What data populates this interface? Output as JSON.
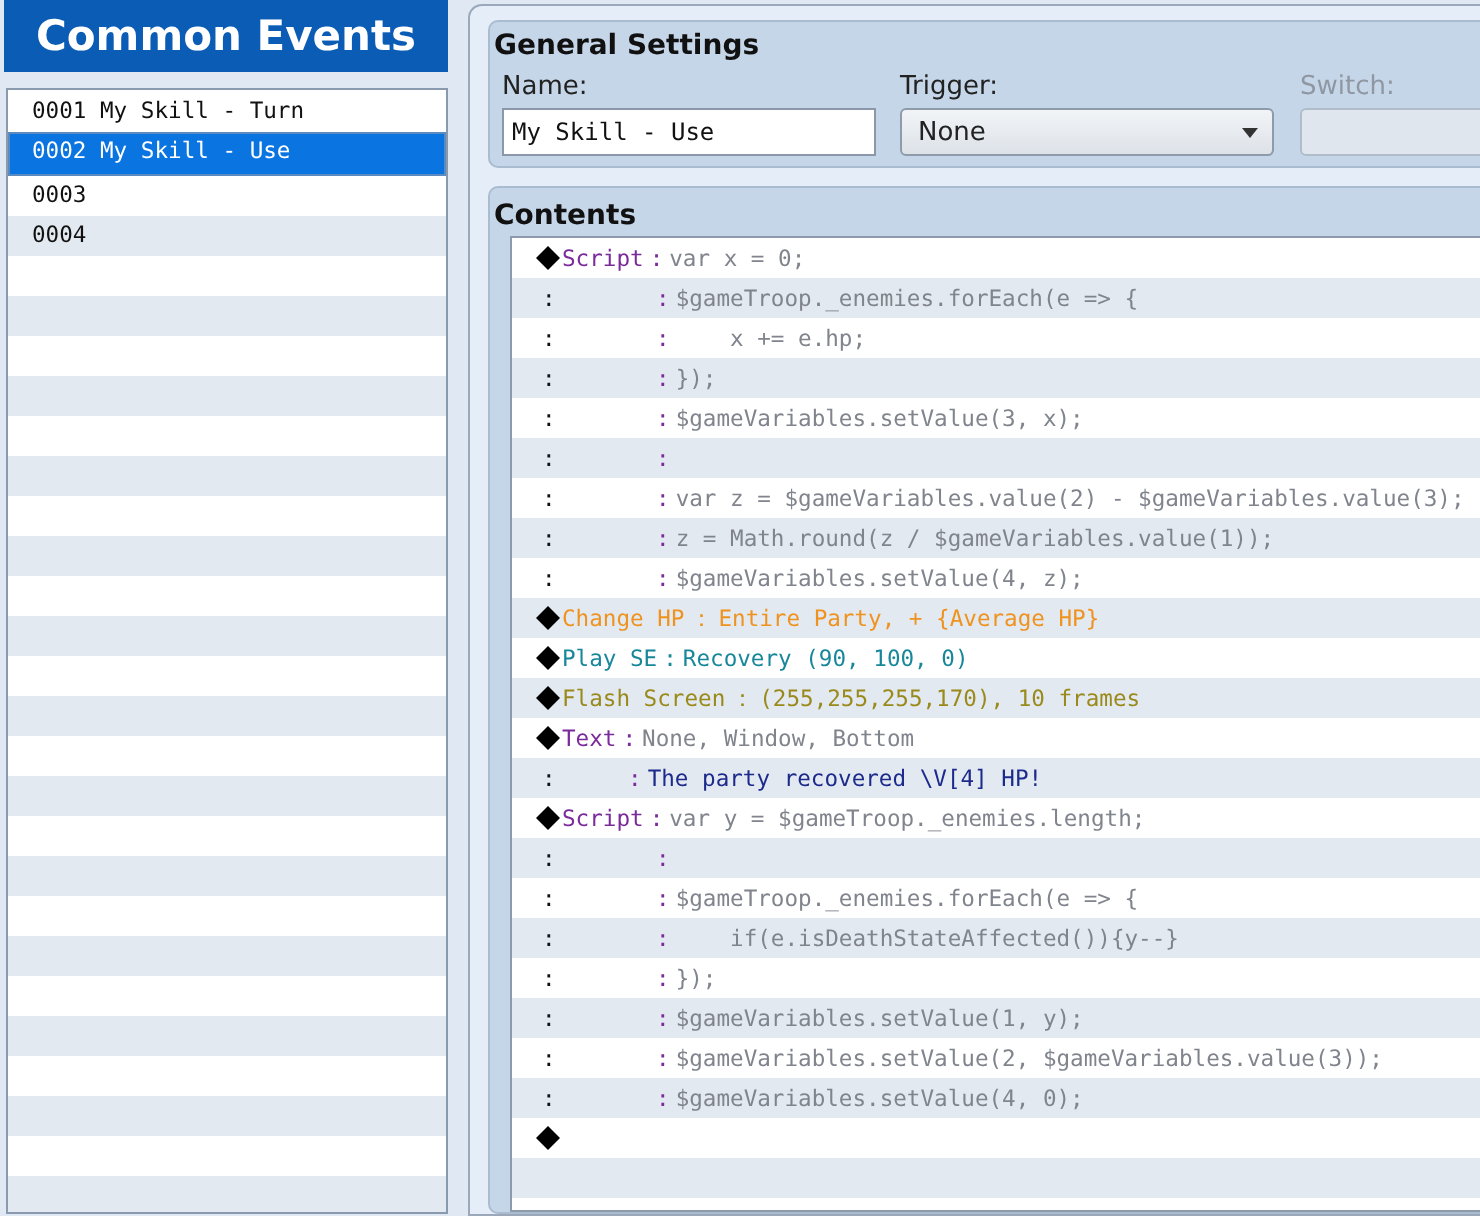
{
  "sidebar": {
    "title": "Common Events",
    "items": [
      {
        "label": "0001 My Skill - Turn",
        "selected": false
      },
      {
        "label": "0002 My Skill - Use",
        "selected": true
      },
      {
        "label": "0003",
        "selected": false
      },
      {
        "label": "0004",
        "selected": false
      }
    ]
  },
  "general_settings": {
    "title": "General Settings",
    "name": {
      "label": "Name:",
      "value": "My Skill - Use"
    },
    "trigger": {
      "label": "Trigger:",
      "value": "None"
    },
    "switch": {
      "label": "Switch:",
      "disabled": true
    }
  },
  "contents": {
    "title": "Contents",
    "lines": [
      {
        "kind": "script",
        "command": "Script",
        "sep": ":",
        "text": "var x = 0;"
      },
      {
        "kind": "script_cont",
        "lead": ":",
        "sep": ":",
        "text": "$gameTroop._enemies.forEach(e => {"
      },
      {
        "kind": "script_cont",
        "lead": ":",
        "sep": ":",
        "text": "    x += e.hp;"
      },
      {
        "kind": "script_cont",
        "lead": ":",
        "sep": ":",
        "text": "});"
      },
      {
        "kind": "script_cont",
        "lead": ":",
        "sep": ":",
        "text": "$gameVariables.setValue(3, x);"
      },
      {
        "kind": "script_cont",
        "lead": ":",
        "sep": ":"
      },
      {
        "kind": "script_cont",
        "lead": ":",
        "sep": ":",
        "text": "var z = $gameVariables.value(2) - $gameVariables.value(3);"
      },
      {
        "kind": "script_cont",
        "lead": ":",
        "sep": ":",
        "text": "z = Math.round(z / $gameVariables.value(1));"
      },
      {
        "kind": "script_cont",
        "lead": ":",
        "sep": ":",
        "text": "$gameVariables.setValue(4, z);"
      },
      {
        "kind": "change_hp",
        "command": "Change HP",
        "sep": "：",
        "text": "Entire Party, + {Average HP}"
      },
      {
        "kind": "play_se",
        "command": "Play SE",
        "sep": ":",
        "text": "Recovery (90, 100, 0)"
      },
      {
        "kind": "flash",
        "command": "Flash Screen",
        "sep": "：",
        "text": "(255,255,255,170), 10 frames"
      },
      {
        "kind": "text",
        "command": "Text",
        "sep": ":",
        "text": "None, Window, Bottom"
      },
      {
        "kind": "text_cont",
        "lead": ":",
        "sep": ":",
        "text": "The party recovered \\V[4] HP!"
      },
      {
        "kind": "script",
        "command": "Script",
        "sep": ":",
        "text": "var y = $gameTroop._enemies.length;"
      },
      {
        "kind": "script_cont",
        "lead": ":",
        "sep": ":"
      },
      {
        "kind": "script_cont",
        "lead": ":",
        "sep": ":",
        "text": "$gameTroop._enemies.forEach(e => {"
      },
      {
        "kind": "script_cont",
        "lead": ":",
        "sep": ":",
        "text": "    if(e.isDeathStateAffected()){y--}"
      },
      {
        "kind": "script_cont",
        "lead": ":",
        "sep": ":",
        "text": "});"
      },
      {
        "kind": "script_cont",
        "lead": ":",
        "sep": ":",
        "text": "$gameVariables.setValue(1, y);"
      },
      {
        "kind": "script_cont",
        "lead": ":",
        "sep": ":",
        "text": "$gameVariables.setValue(2, $gameVariables.value(3));"
      },
      {
        "kind": "script_cont",
        "lead": ":",
        "sep": ":",
        "text": "$gameVariables.setValue(4, 0);"
      },
      {
        "kind": "end"
      }
    ]
  }
}
